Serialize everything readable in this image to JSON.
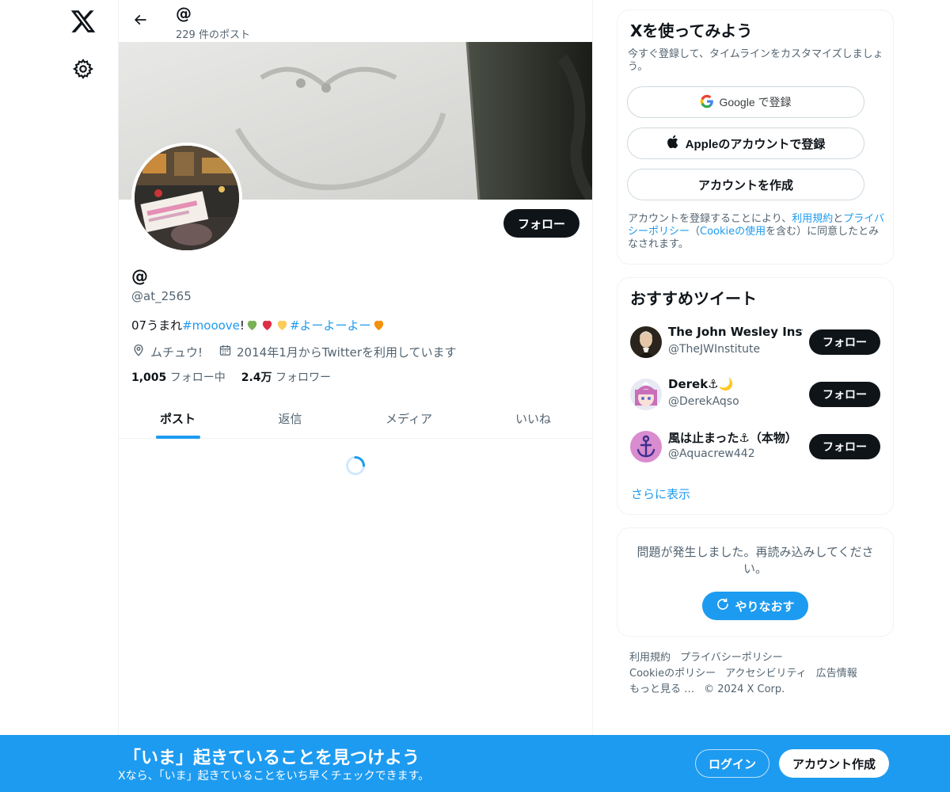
{
  "header": {
    "display_name": "@",
    "post_count": "229 件のポスト"
  },
  "profile": {
    "display_name": "@",
    "handle": "@at_2565",
    "bio_prefix": "07うまれ ",
    "bio_hashtag1": "#mooove",
    "bio_mid": "!",
    "bio_hashtag2": "#よーよーよー",
    "location": "ムチュウ!",
    "joined": "2014年1月からTwitterを利用しています",
    "following_count": "1,005",
    "following_label": "フォロー中",
    "followers_count": "2.4万",
    "followers_label": "フォロワー",
    "follow_label": "フォロー"
  },
  "tabs": [
    {
      "label": "ポスト",
      "active": true
    },
    {
      "label": "返信",
      "active": false
    },
    {
      "label": "メディア",
      "active": false
    },
    {
      "label": "いいね",
      "active": false
    }
  ],
  "signup": {
    "title": "Xを使ってみよう",
    "subtitle": "今すぐ登録して、タイムラインをカスタマイズしましょう。",
    "google_label": "Google で登録",
    "apple_label": "Appleのアカウントで登録",
    "create_label": "アカウントを作成",
    "terms_pre": "アカウントを登録することにより、",
    "terms_link1": "利用規約",
    "terms_and": "と",
    "terms_link2": "プライバシーポリシー",
    "terms_mid": "（",
    "terms_link3": "Cookieの使用",
    "terms_post": "を含む）に同意したとみなされます。"
  },
  "recommend": {
    "title": "おすすめツイート",
    "items": [
      {
        "name": "The John Wesley Instit",
        "handle": "@TheJWInstitute",
        "follow": "フォロー"
      },
      {
        "name": "Derek⚓🌙",
        "handle": "@DerekAqso",
        "follow": "フォロー"
      },
      {
        "name": "風は止まった⚓（本物）",
        "handle": "@Aquacrew442",
        "follow": "フォロー"
      }
    ],
    "more": "さらに表示"
  },
  "error": {
    "message": "問題が発生しました。再読み込みしてください。",
    "retry": "やりなおす"
  },
  "footer": {
    "links": [
      "利用規約",
      "プライバシーポリシー",
      "Cookieのポリシー",
      "アクセシビリティ",
      "広告情報",
      "もっと見る …"
    ],
    "copyright": "© 2024 X Corp."
  },
  "bottom_bar": {
    "title": "「いま」起きていることを見つけよう",
    "subtitle": "Xなら、「いま」起きていることをいち早くチェックできます。",
    "login": "ログイン",
    "signup": "アカウント作成"
  },
  "colors": {
    "accent": "#1d9bf0",
    "text": "#0f1419",
    "secondary": "#536471"
  },
  "icons": [
    "x-logo-icon",
    "gear-icon",
    "back-arrow-icon",
    "location-icon",
    "calendar-icon",
    "google-icon",
    "apple-icon",
    "refresh-icon",
    "spinner-icon",
    "green-heart-icon",
    "red-heart-icon",
    "yellow-heart-icon",
    "orange-heart-icon"
  ]
}
